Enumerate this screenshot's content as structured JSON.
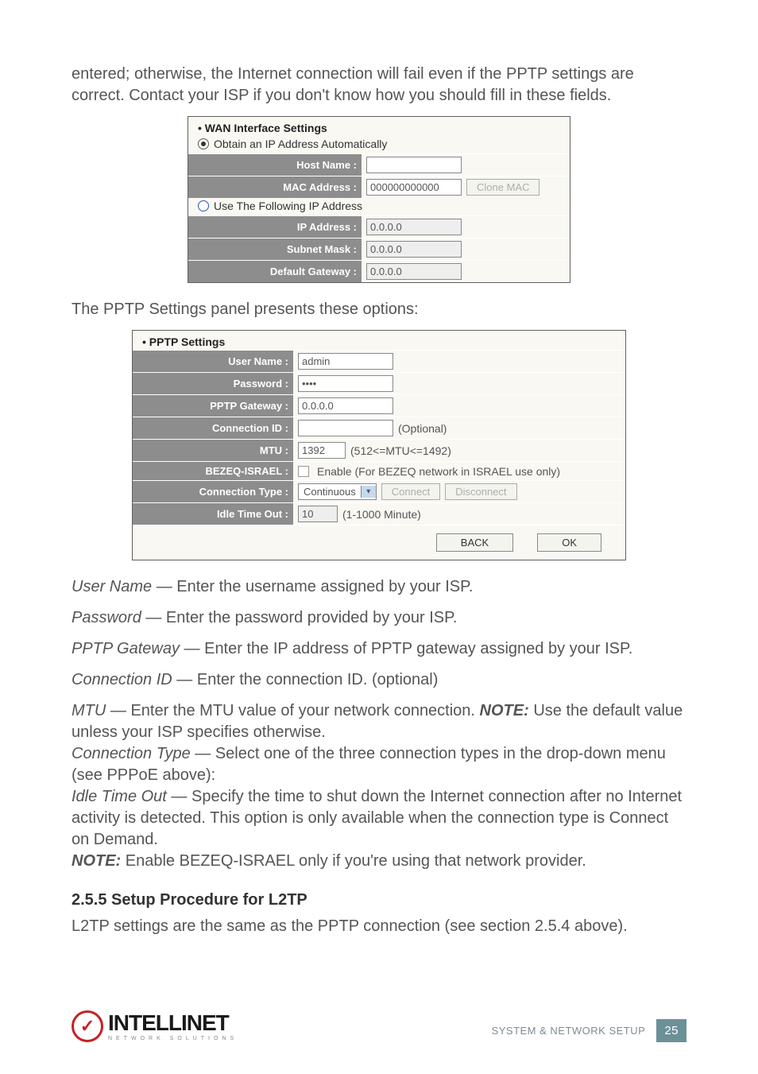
{
  "intro_text": "entered; otherwise, the Internet connection will fail even if the PPTP settings are correct. Contact your ISP if you don't know how you should fill in these fields.",
  "wan_panel": {
    "title": "WAN Interface Settings",
    "radio_auto": "Obtain an IP Address Automatically",
    "radio_static": "Use The Following IP Address",
    "rows": {
      "host_name": {
        "label": "Host Name :",
        "value": ""
      },
      "mac": {
        "label": "MAC Address :",
        "value": "000000000000",
        "button": "Clone MAC"
      },
      "ip": {
        "label": "IP Address :",
        "value": "0.0.0.0"
      },
      "subnet": {
        "label": "Subnet Mask :",
        "value": "0.0.0.0"
      },
      "gateway": {
        "label": "Default Gateway :",
        "value": "0.0.0.0"
      }
    }
  },
  "pptp_intro": "The PPTP Settings panel presents these options:",
  "pptp_panel": {
    "title": "PPTP Settings",
    "rows": {
      "user": {
        "label": "User Name :",
        "value": "admin"
      },
      "pass": {
        "label": "Password :",
        "value": "••••"
      },
      "gateway": {
        "label": "PPTP Gateway :",
        "value": "0.0.0.0"
      },
      "connid": {
        "label": "Connection ID :",
        "value": "",
        "hint": "(Optional)"
      },
      "mtu": {
        "label": "MTU :",
        "value": "1392",
        "hint": "(512<=MTU<=1492)"
      },
      "bezeq": {
        "label": "BEZEQ-ISRAEL :",
        "hint": "Enable (For BEZEQ network in ISRAEL use only)"
      },
      "conntype": {
        "label": "Connection Type :",
        "value": "Continuous",
        "btn1": "Connect",
        "btn2": "Disconnect"
      },
      "idle": {
        "label": "Idle Time Out :",
        "value": "10",
        "hint": "(1-1000 Minute)"
      }
    },
    "back": "BACK",
    "ok": "OK"
  },
  "descs": {
    "user_l": "User Name",
    "user_t": " — Enter the username assigned by your ISP.",
    "pass_l": "Password",
    "pass_t": " — Enter the password provided by your ISP.",
    "pptp_l": "PPTP Gateway",
    "pptp_t": " — Enter the IP address of PPTP gateway assigned by your ISP.",
    "cid_l": "Connection ID",
    "cid_t": " — Enter the connection ID. (optional)",
    "mtu_l": "MTU",
    "mtu_t1": " — Enter the MTU value of your network connection. ",
    "mtu_note": "NOTE:",
    "mtu_t2": " Use the default value unless your ISP specifies otherwise.",
    "ct_l": "Connection Type",
    "ct_t": " — Select one of the three connection types in the drop-down menu (see PPPoE above):",
    "idle_l": "Idle Time Out",
    "idle_t": " — Specify the time to shut down the Internet connection after no Internet activity is detected. This option is only available when the connection type is Connect on Demand.",
    "note_l": "NOTE:",
    "note_t": " Enable BEZEQ-ISRAEL only if you're using that network provider."
  },
  "section_heading": "2.5.5  Setup Procedure for L2TP",
  "section_body": "L2TP settings are the same as the PPTP connection (see section 2.5.4 above).",
  "footer": {
    "logo_main": "INTELLINET",
    "logo_sub": "NETWORK  SOLUTIONS",
    "ref": "SYSTEM & NETWORK SETUP",
    "page": "25"
  }
}
